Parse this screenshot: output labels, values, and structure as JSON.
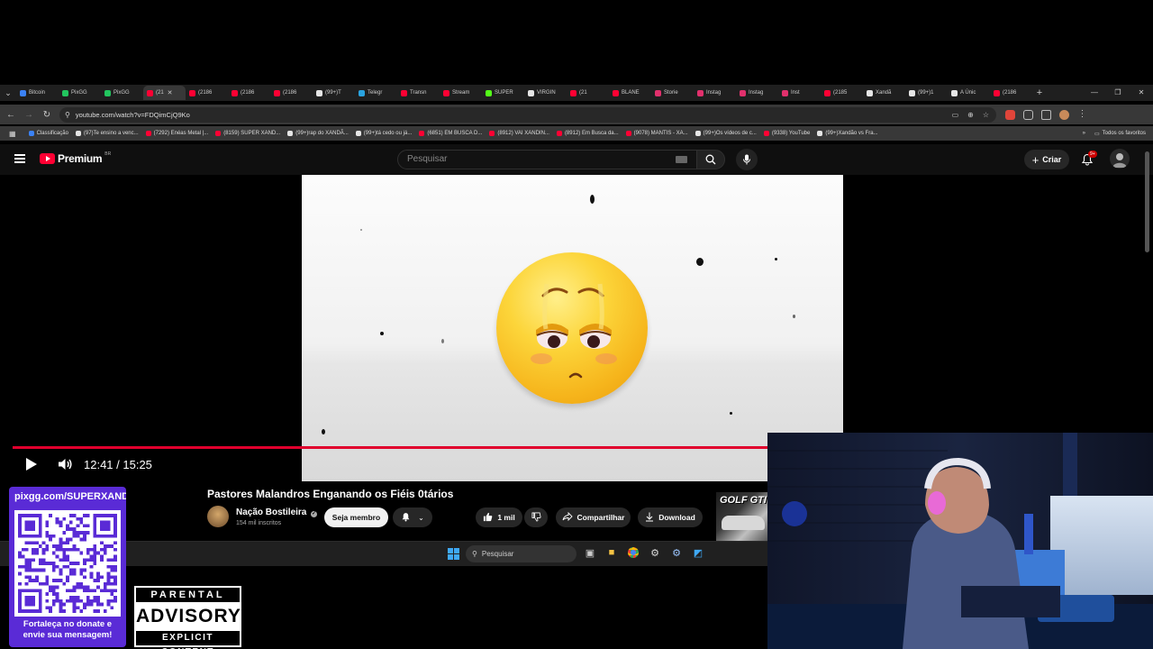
{
  "browser": {
    "tabs": [
      {
        "label": "Bitcoin",
        "color": "#3b82f6",
        "active": false
      },
      {
        "label": "PixGG",
        "color": "#22c55e",
        "active": false
      },
      {
        "label": "PixGG",
        "color": "#22c55e",
        "active": false
      },
      {
        "label": "(21",
        "color": "#ff0033",
        "active": true
      },
      {
        "label": "(2186",
        "color": "#ff0033",
        "active": false
      },
      {
        "label": "(2186",
        "color": "#ff0033",
        "active": false
      },
      {
        "label": "(2186",
        "color": "#ff0033",
        "active": false
      },
      {
        "label": "(99+)T",
        "color": "#e5e5e5",
        "active": false
      },
      {
        "label": "Telegr",
        "color": "#2aa3df",
        "active": false
      },
      {
        "label": "Transn",
        "color": "#ff0033",
        "active": false
      },
      {
        "label": "Stream",
        "color": "#ff0033",
        "active": false
      },
      {
        "label": "SUPER",
        "color": "#53fc18",
        "active": false
      },
      {
        "label": "VIRGIN",
        "color": "#e5e5e5",
        "active": false
      },
      {
        "label": "(21",
        "color": "#ff0033",
        "active": false
      },
      {
        "label": "BLANE",
        "color": "#ff0033",
        "active": false
      },
      {
        "label": "Storie",
        "color": "#e1306c",
        "active": false
      },
      {
        "label": "Instag",
        "color": "#e1306c",
        "active": false
      },
      {
        "label": "Instag",
        "color": "#e1306c",
        "active": false
      },
      {
        "label": "Inst",
        "color": "#e1306c",
        "active": false
      },
      {
        "label": "(2185",
        "color": "#ff0033",
        "active": false
      },
      {
        "label": "Xandã",
        "color": "#e5e5e5",
        "active": false
      },
      {
        "label": "(99+)1",
        "color": "#e5e5e5",
        "active": false
      },
      {
        "label": "A Únic",
        "color": "#e5e5e5",
        "active": false
      },
      {
        "label": "(2186",
        "color": "#ff0033",
        "active": false
      }
    ],
    "url": "youtube.com/watch?v=FDQimCjQ9Ko",
    "bookmarks": [
      {
        "label": "Classificação",
        "color": "#3b82f6"
      },
      {
        "label": "(97)Te ensino a venc...",
        "color": "#e5e5e5"
      },
      {
        "label": "(7292) Enéas Metal |...",
        "color": "#ff0033"
      },
      {
        "label": "(8159) SUPER XAND...",
        "color": "#ff0033"
      },
      {
        "label": "(99+)rap do XANDÃ...",
        "color": "#e5e5e5"
      },
      {
        "label": "(99+)tá cedo ou já...",
        "color": "#e5e5e5"
      },
      {
        "label": "(6851) EM BUSCA D...",
        "color": "#ff0033"
      },
      {
        "label": "(8912) VAI XANDIN...",
        "color": "#ff0033"
      },
      {
        "label": "(8912) Em Busca da...",
        "color": "#ff0033"
      },
      {
        "label": "(9078) MANTIS - XA...",
        "color": "#ff0033"
      },
      {
        "label": "(99+)Os vídeos de c...",
        "color": "#e5e5e5"
      },
      {
        "label": "(9338) YouTube",
        "color": "#ff0033"
      },
      {
        "label": "(99+)Xandão vs Fra...",
        "color": "#e5e5e5"
      }
    ],
    "bookmarks_more": "»",
    "all_bookmarks": "Todos os favoritos"
  },
  "youtube": {
    "logo_text": "Premium",
    "region": "BR",
    "search_placeholder": "Pesquisar",
    "create_label": "Criar",
    "notifications_badge": "9+",
    "player": {
      "current_time": "12:41",
      "duration": "15:25",
      "time_display": "12:41 / 15:25",
      "progress": 0.822
    },
    "video": {
      "title": "Pastores Malandros Enganando os Fiéis 0tários",
      "channel_name": "Nação Bostileira",
      "subscribers": "154 mil inscritos",
      "join_label": "Seja membro",
      "likes": "1 mil",
      "share_label": "Compartilhar",
      "download_label": "Download"
    },
    "suggested_thumb_text": "GOLF GTI"
  },
  "taskbar": {
    "search_placeholder": "Pesquisar"
  },
  "overlay": {
    "qr_url": "pixgg.com/SUPERXANDÃ",
    "qr_caption_1": "Fortaleça no donate e",
    "qr_caption_2": "envie sua mensagem!",
    "pa_top": "PARENTAL",
    "pa_mid": "ADVISORY",
    "pa_bottom": "EXPLICIT CONTENT"
  },
  "colors": {
    "yt_red": "#ff0033",
    "progress_red": "#e1002d",
    "qr_purple": "#5a2bd6"
  }
}
